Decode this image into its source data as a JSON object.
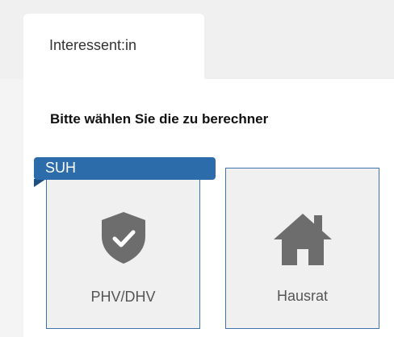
{
  "tabs": [
    {
      "label": "Interessent:in"
    }
  ],
  "instruction": "Bitte wählen Sie die zu berechner",
  "badge": {
    "label": "SUH"
  },
  "products": [
    {
      "label": "PHV/DHV",
      "icon": "shield-check-icon"
    },
    {
      "label": "Hausrat",
      "icon": "house-icon"
    }
  ],
  "colors": {
    "accent": "#2c6cab",
    "card_border": "#3d73ad",
    "icon": "#6d6d6d"
  }
}
